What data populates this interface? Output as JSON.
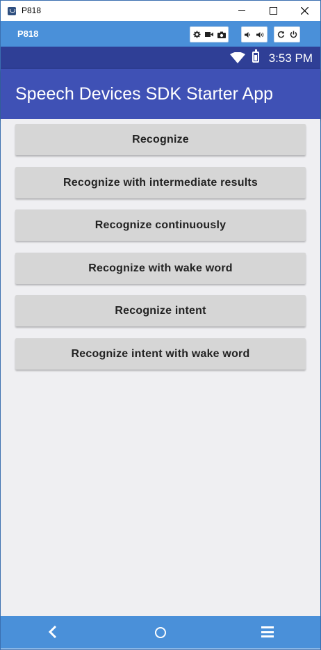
{
  "window": {
    "title": "P818",
    "controls": [
      "minimize",
      "maximize",
      "close"
    ]
  },
  "emulator": {
    "device_name": "P818",
    "toolbar_icons": [
      "gear-icon",
      "video-camera-icon",
      "camera-icon",
      "volume-down-icon",
      "volume-up-icon",
      "rotate-icon",
      "power-icon"
    ]
  },
  "status_bar": {
    "time": "3:53 PM",
    "icons": [
      "wifi-icon",
      "battery-icon"
    ]
  },
  "app": {
    "title": "Speech Devices SDK Starter App"
  },
  "buttons": [
    {
      "label": "Recognize"
    },
    {
      "label": "Recognize with intermediate results"
    },
    {
      "label": "Recognize continuously"
    },
    {
      "label": "Recognize with wake word"
    },
    {
      "label": "Recognize intent"
    },
    {
      "label": "Recognize intent with wake word"
    }
  ],
  "nav_bar": {
    "icons": [
      "back-icon",
      "home-icon",
      "menu-icon"
    ]
  },
  "colors": {
    "app_bar": "#3f51b5",
    "status_bar": "#2f3f96",
    "emulator_bar": "#4a90d9",
    "button": "#d6d6d6",
    "background": "#efeff2"
  }
}
